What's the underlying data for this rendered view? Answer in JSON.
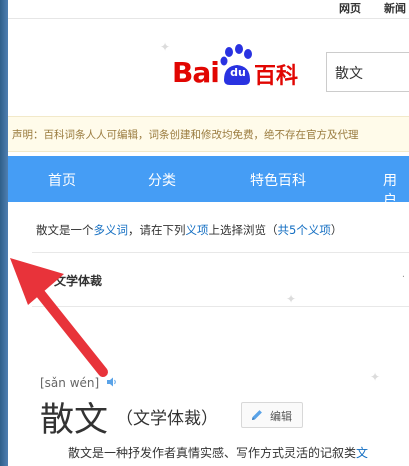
{
  "top_nav": {
    "web": "网页",
    "news": "新闻"
  },
  "logo": {
    "bai": "Bai",
    "du": "du",
    "baike": "百科"
  },
  "search": {
    "value": "散文"
  },
  "notice": {
    "text": "声明：百科词条人人可编辑，词条创建和修改均免费，绝不存在官方及代理"
  },
  "menu": {
    "items": [
      "首页",
      "分类",
      "特色百科",
      "用户"
    ]
  },
  "polysemy": {
    "term": "散文",
    "text1": "是一个",
    "link1": "多义词",
    "text2": "，请在下列",
    "link2": "义项",
    "text3": "上选择浏览（",
    "link3": "共5个义项",
    "text4": "）",
    "sense": "文学体裁",
    "sense_more": "·"
  },
  "entry": {
    "pinyin": "[sǎn wén]",
    "title": "散文",
    "subtitle": "（文学体裁）",
    "edit_label": "编辑",
    "summary_text": "散文是一种抒发作者真情实感、写作方式灵活的记叙类",
    "summary_link": "文"
  },
  "colors": {
    "brand_red": "#e10602",
    "menu_blue": "#459df5",
    "link_blue": "#136ec2",
    "arrow_red": "#e8333a"
  }
}
